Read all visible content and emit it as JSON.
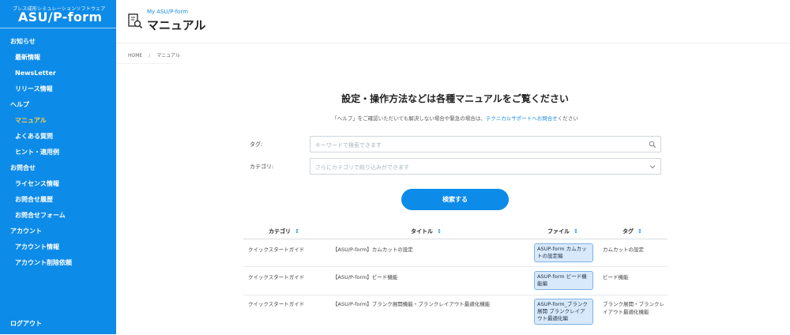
{
  "sidebar": {
    "logo_sub": "プレス成形シミュレーションソフトウェア",
    "logo_main": "ASU/P-form",
    "sections": [
      {
        "label": "お知らせ",
        "items": [
          "最新情報",
          "NewsLetter",
          "リリース情報"
        ]
      },
      {
        "label": "ヘルプ",
        "items": [
          "マニュアル",
          "よくある質問",
          "ヒント・適用例"
        ]
      },
      {
        "label": "お問合せ",
        "items": [
          "ライセンス情報",
          "お問合せ履歴",
          "お問合せフォーム"
        ]
      },
      {
        "label": "アカウント",
        "items": [
          "アカウント情報",
          "アカウント削除依頼"
        ]
      }
    ],
    "active_item": "マニュアル",
    "logout": "ログアウト"
  },
  "header": {
    "sub": "My ASU/P-form",
    "title": "マニュアル"
  },
  "breadcrumb": {
    "home": "HOME",
    "sep": "/",
    "current": "マニュアル"
  },
  "main": {
    "heading": "設定・操作方法などは各種マニュアルをご覧ください",
    "notice_pre": "「ヘルプ」をご確認いただいても解決しない場合や緊急の場合は、",
    "notice_link": "テクニカルサポートへお問合せ",
    "notice_post": "ください"
  },
  "form": {
    "tag_label": "タグ:",
    "tag_placeholder": "キーワードで検索できます",
    "category_label": "カテゴリ:",
    "category_placeholder": "さらにカテゴリで絞り込みができます",
    "search_button": "検索する"
  },
  "table": {
    "headers": [
      "カテゴリ",
      "タイトル",
      "ファイル",
      "タグ"
    ],
    "sort_icon": "↕",
    "rows": [
      {
        "category": "クイックスタートガイド",
        "title": "【ASU/P-form】カムカットの設定",
        "file": "ASUP-form カムカットの設定編",
        "tag": "カムカットの設定"
      },
      {
        "category": "クイックスタートガイド",
        "title": "【ASU/P-form】ビード機能",
        "file": "ASUP-form ビード機能編",
        "tag": "ビード機能"
      },
      {
        "category": "クイックスタートガイド",
        "title": "【ASU/P-form】ブランク展開機能・ブランクレイアウト最適化機能",
        "file": "ASUP-form_ブランク展開 ブランクレイアウト最適化編",
        "tag": "ブランク展開・ブランクレイアウト最適化機能"
      }
    ]
  },
  "colors": {
    "primary": "#0d8be8",
    "active_nav": "#ffd24a",
    "link": "#1a8be0",
    "badge_bg": "#d8e9fb"
  },
  "icons": {
    "page": "manual-search-icon",
    "search": "search-icon",
    "dropdown": "chevron-down-icon",
    "sort": "sort-icon"
  }
}
